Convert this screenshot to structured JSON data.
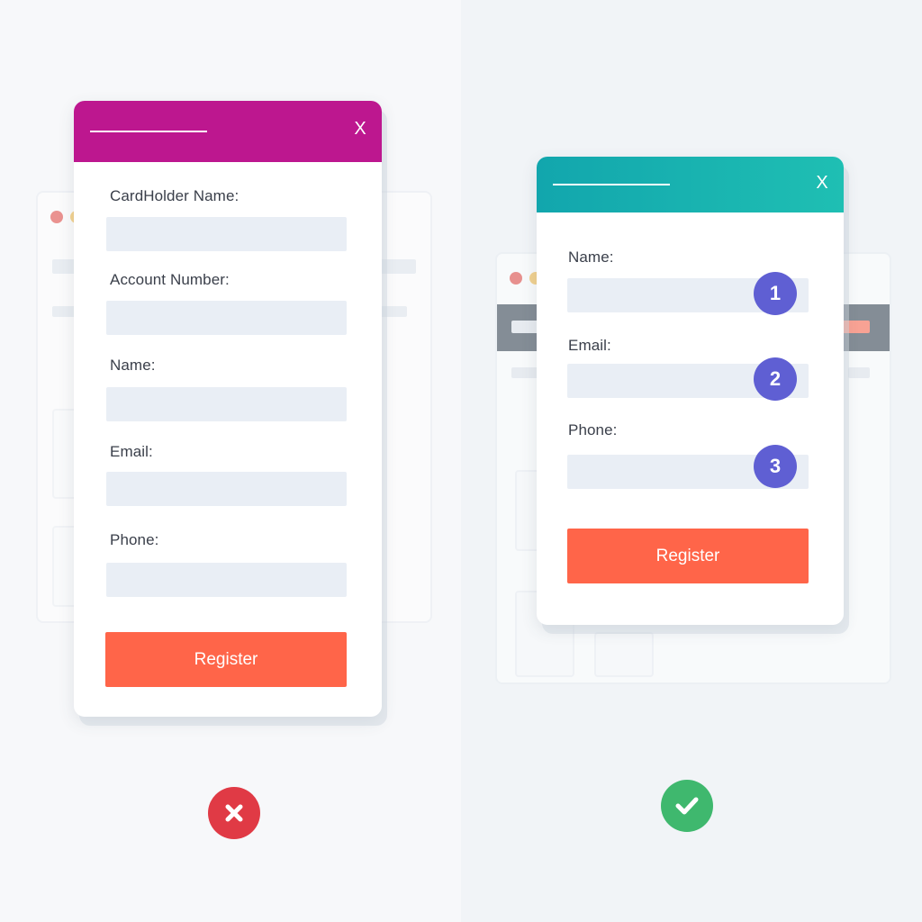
{
  "left_panel": {
    "modal": {
      "close_label": "X",
      "fields": [
        {
          "label": "CardHolder Name:",
          "value": ""
        },
        {
          "label": "Account Number:",
          "value": ""
        },
        {
          "label": "Name:",
          "value": ""
        },
        {
          "label": "Email:",
          "value": ""
        },
        {
          "label": "Phone:",
          "value": ""
        }
      ],
      "submit_label": "Register",
      "header_color": "#bd178f"
    },
    "verdict": {
      "icon": "cross-icon",
      "color": "#e03a45"
    }
  },
  "right_panel": {
    "modal": {
      "close_label": "X",
      "fields": [
        {
          "label": "Name:",
          "value": "",
          "step": "1"
        },
        {
          "label": "Email:",
          "value": "",
          "step": "2"
        },
        {
          "label": "Phone:",
          "value": "",
          "step": "3"
        }
      ],
      "submit_label": "Register",
      "header_color": "#12a6ad",
      "step_badge_color": "#5f5fd3"
    },
    "verdict": {
      "icon": "check-icon",
      "color": "#3fb86e"
    }
  },
  "colors": {
    "button": "#ff6549",
    "input_background": "#e9eef5"
  }
}
